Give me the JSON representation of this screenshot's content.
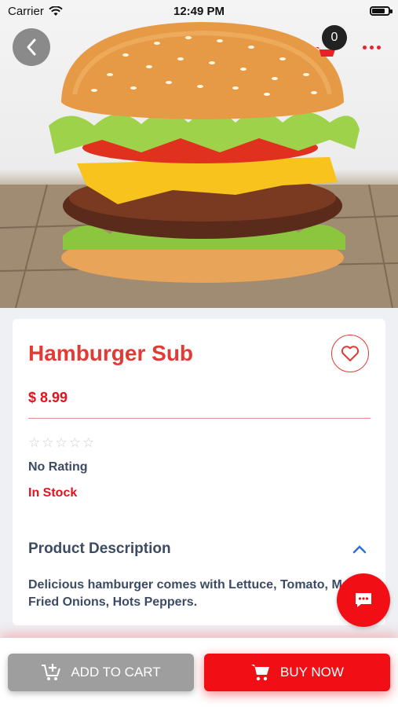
{
  "status_bar": {
    "carrier": "Carrier",
    "time": "12:49 PM",
    "battery_level": 0.9
  },
  "header": {
    "cart_count": "0"
  },
  "product": {
    "title": "Hamburger Sub",
    "price": "$ 8.99",
    "rating_stars": 0,
    "rating_text": "No Rating",
    "stock_status": "In Stock",
    "description_title": "Product Description",
    "description": "Delicious hamburger comes with Lettuce, Tomato, Mayo, Fried Onions, Hots Peppers."
  },
  "actions": {
    "add_to_cart": "ADD TO CART",
    "buy_now": "BUY NOW"
  },
  "colors": {
    "accent": "#e4121c",
    "title": "#e23a35",
    "text": "#3d4a64",
    "button_grey": "#9e9e9e"
  },
  "icons": [
    "back-arrow-icon",
    "cart-icon",
    "more-icon",
    "heart-icon",
    "star-icon",
    "chevron-up-icon",
    "chat-icon",
    "add-cart-icon",
    "cart-icon"
  ]
}
